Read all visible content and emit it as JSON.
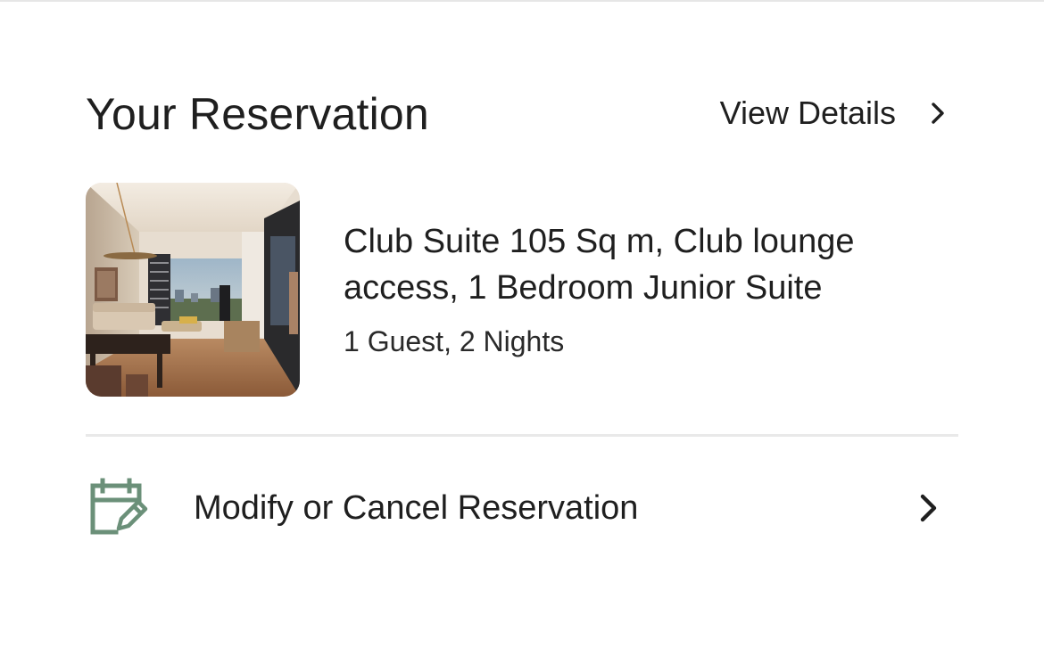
{
  "header": {
    "title": "Your Reservation",
    "view_details_label": "View Details"
  },
  "reservation": {
    "room_name": "Club Suite 105 Sq m, Club lounge access, 1 Bedroom Junior Suite",
    "stay_summary": "1 Guest, 2 Nights"
  },
  "actions": {
    "modify_label": "Modify or Cancel Reservation"
  },
  "colors": {
    "text": "#1f1f1f",
    "icon_accent": "#6b9079",
    "divider": "#e9e9e9"
  },
  "icons": {
    "view_details": "chevron-right-icon",
    "modify": "calendar-edit-icon",
    "modify_row_arrow": "chevron-right-icon"
  }
}
